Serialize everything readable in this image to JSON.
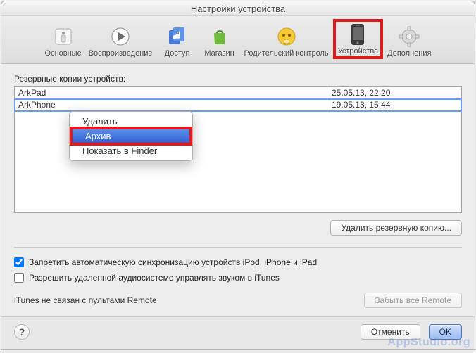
{
  "window": {
    "title": "Настройки устройства"
  },
  "toolbar": {
    "items": [
      {
        "label": "Основные"
      },
      {
        "label": "Воспроизведение"
      },
      {
        "label": "Доступ"
      },
      {
        "label": "Магазин"
      },
      {
        "label": "Родительский контроль"
      },
      {
        "label": "Устройства"
      },
      {
        "label": "Дополнения"
      }
    ]
  },
  "backups": {
    "section_label": "Резервные копии устройств:",
    "rows": [
      {
        "name": "ArkPad",
        "date": "25.05.13, 22:20"
      },
      {
        "name": "ArkPhone",
        "date": "19.05.13, 15:44"
      }
    ],
    "delete_button": "Удалить резервную копию..."
  },
  "context_menu": {
    "items": [
      {
        "label": "Удалить"
      },
      {
        "label": "Архив"
      },
      {
        "label": "Показать в Finder"
      }
    ]
  },
  "checks": {
    "disable_autosync": "Запретить автоматическую синхронизацию устройств iPod, iPhone и iPad",
    "allow_remote_audio": "Разрешить удаленной аудиосистеме управлять звуком в iTunes"
  },
  "remote": {
    "status": "iTunes не связан с пультами Remote",
    "forget_button": "Забыть все Remote"
  },
  "footer": {
    "help": "?",
    "cancel": "Отменить",
    "ok": "OK"
  },
  "watermark": "AppStudio.org"
}
